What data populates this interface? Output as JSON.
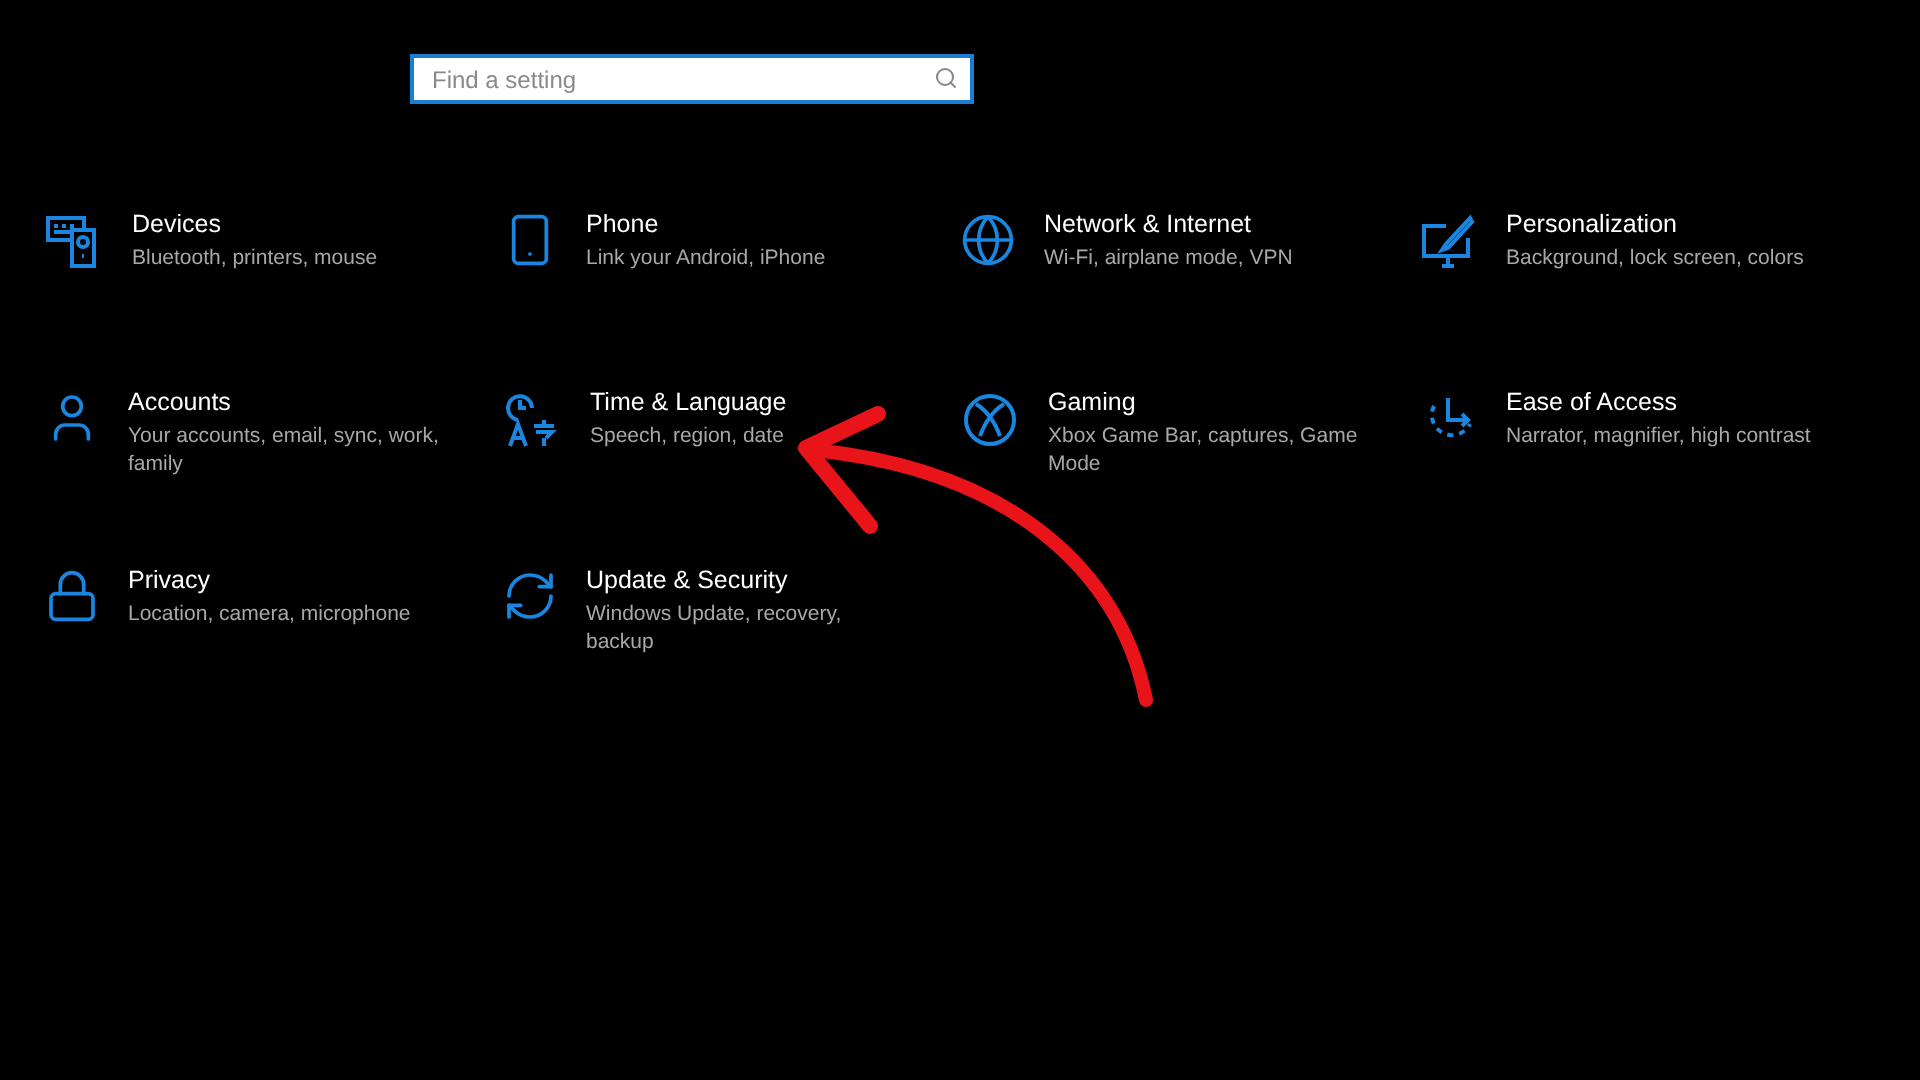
{
  "search": {
    "placeholder": "Find a setting"
  },
  "categories": [
    {
      "kind": "devices",
      "title": "Devices",
      "description": "Bluetooth, printers, mouse"
    },
    {
      "kind": "phone",
      "title": "Phone",
      "description": "Link your Android, iPhone"
    },
    {
      "kind": "network",
      "title": "Network & Internet",
      "description": "Wi-Fi, airplane mode, VPN"
    },
    {
      "kind": "personalization",
      "title": "Personalization",
      "description": "Background, lock screen, colors"
    },
    {
      "kind": "accounts",
      "title": "Accounts",
      "description": "Your accounts, email, sync, work, family"
    },
    {
      "kind": "time",
      "title": "Time & Language",
      "description": "Speech, region, date"
    },
    {
      "kind": "gaming",
      "title": "Gaming",
      "description": "Xbox Game Bar, captures, Game Mode"
    },
    {
      "kind": "ease",
      "title": "Ease of Access",
      "description": "Narrator, magnifier, high contrast"
    },
    {
      "kind": "privacy",
      "title": "Privacy",
      "description": "Location, camera, microphone"
    },
    {
      "kind": "update",
      "title": "Update & Security",
      "description": "Windows Update, recovery, backup"
    }
  ]
}
